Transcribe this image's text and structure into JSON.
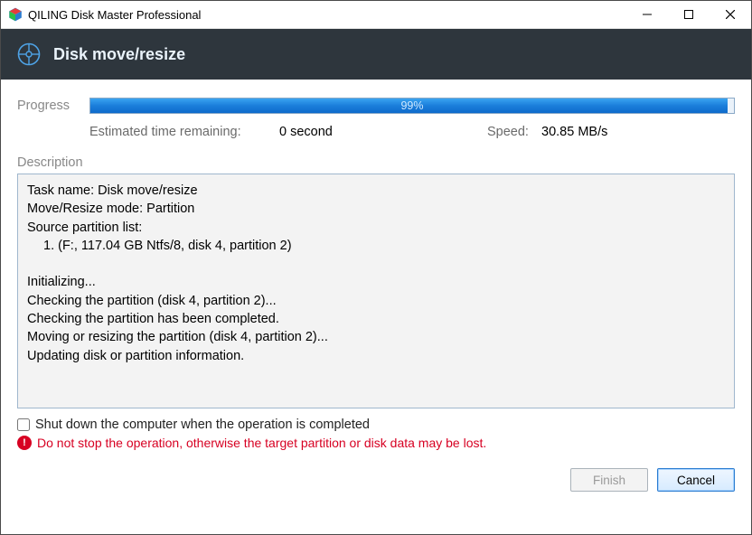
{
  "titlebar": {
    "title": "QILING Disk Master Professional"
  },
  "header": {
    "title": "Disk move/resize"
  },
  "progress": {
    "label": "Progress",
    "percent_text": "99%",
    "percent": 99,
    "etr_label": "Estimated time remaining:",
    "etr_value": "0 second",
    "speed_label": "Speed:",
    "speed_value": "30.85 MB/s"
  },
  "description": {
    "label": "Description",
    "lines": {
      "task_name": "Task name: Disk move/resize",
      "mode": "Move/Resize mode: Partition",
      "source_header": "Source partition list:",
      "source_item": "1. (F:, 117.04 GB Ntfs/8, disk 4, partition 2)",
      "init": "Initializing...",
      "check1": "Checking the partition (disk 4, partition 2)...",
      "check2": "Checking the partition has been completed.",
      "resize": "Moving or resizing the partition (disk 4, partition 2)...",
      "update": "Updating disk or partition information."
    }
  },
  "shutdown": {
    "label": "Shut down the computer when the operation is completed"
  },
  "warning": {
    "text": "Do not stop the operation, otherwise the target partition or disk data may be lost."
  },
  "buttons": {
    "finish": "Finish",
    "cancel": "Cancel"
  }
}
